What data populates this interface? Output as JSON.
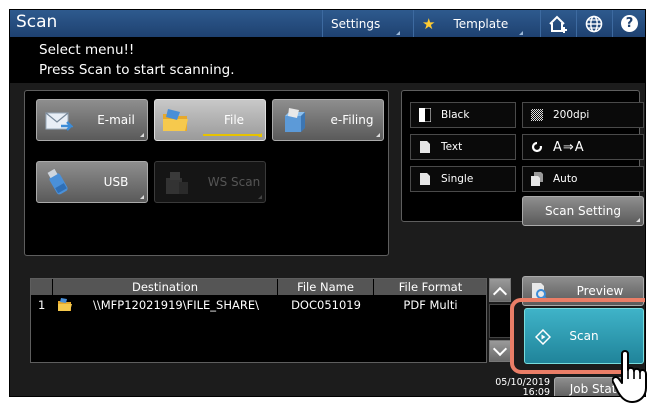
{
  "header": {
    "title": "Scan",
    "settings_label": "Settings",
    "template_label": "Template",
    "home_icon": "home-icon",
    "globe_icon": "globe-icon",
    "help_label": "?"
  },
  "message": {
    "line1": "Select menu!!",
    "line2": "Press Scan to start scanning."
  },
  "functions": [
    {
      "label": "E-mail",
      "icon": "email-icon",
      "selected": false,
      "enabled": true
    },
    {
      "label": "File",
      "icon": "folder-icon",
      "selected": true,
      "enabled": true
    },
    {
      "label": "e-Filing",
      "icon": "efiling-icon",
      "selected": false,
      "enabled": true
    },
    {
      "label": "USB",
      "icon": "usb-icon",
      "selected": false,
      "enabled": true
    },
    {
      "label": "WS Scan",
      "icon": "ws-scan-icon",
      "selected": false,
      "enabled": false
    }
  ],
  "scan_settings": {
    "color_mode": "Black",
    "resolution": "200dpi",
    "original_mode": "Text",
    "rotation": "A⇒A",
    "sides": "Single",
    "size": "Auto",
    "scan_setting_button": "Scan Setting"
  },
  "destination_table": {
    "columns": [
      "Destination",
      "File Name",
      "File Format"
    ],
    "rows": [
      {
        "index": "1",
        "destination": "\\\\MFP12021919\\FILE_SHARE\\",
        "file_name": "DOC051019",
        "file_format": "PDF Multi"
      }
    ]
  },
  "actions": {
    "preview_label": "Preview",
    "scan_label": "Scan",
    "job_status_label": "Job Status"
  },
  "status": {
    "date": "05/10/2019",
    "time": "16:09"
  },
  "colors": {
    "header_blue": "#1e4170",
    "scan_button": "#2a9fb5",
    "highlight": "#ea7e67",
    "selected_underline": "#e6c200"
  }
}
